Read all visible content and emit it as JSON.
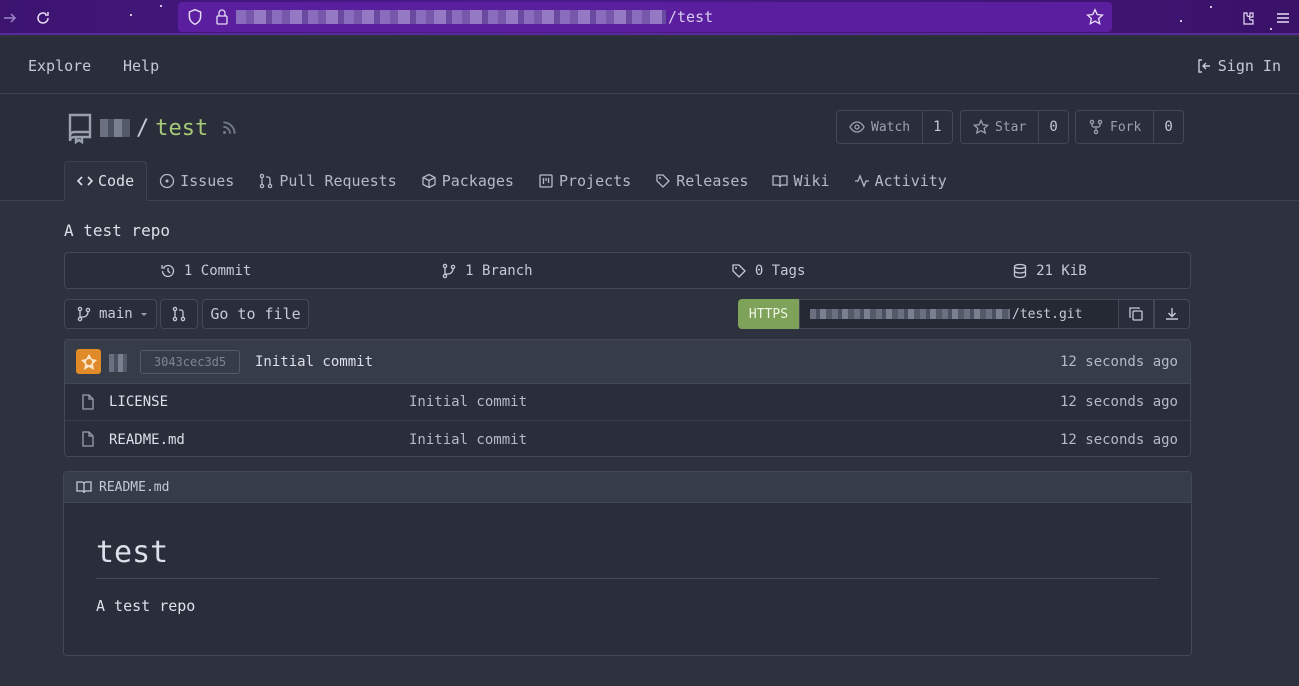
{
  "browser": {
    "url_path": "/test"
  },
  "topnav": {
    "explore": "Explore",
    "help": "Help",
    "sign_in": "Sign In"
  },
  "repo": {
    "slash": "/",
    "name": "test",
    "watch_label": "Watch",
    "watch_count": "1",
    "star_label": "Star",
    "star_count": "0",
    "fork_label": "Fork",
    "fork_count": "0",
    "description": "A test repo"
  },
  "tabs": [
    {
      "label": "Code",
      "icon": "code-icon"
    },
    {
      "label": "Issues",
      "icon": "issue-icon"
    },
    {
      "label": "Pull Requests",
      "icon": "pull-request-icon"
    },
    {
      "label": "Packages",
      "icon": "package-icon"
    },
    {
      "label": "Projects",
      "icon": "project-icon"
    },
    {
      "label": "Releases",
      "icon": "tag-icon"
    },
    {
      "label": "Wiki",
      "icon": "book-icon"
    },
    {
      "label": "Activity",
      "icon": "pulse-icon"
    }
  ],
  "summary": {
    "commits": "1 Commit",
    "branches": "1 Branch",
    "tags": "0 Tags",
    "size": "21 KiB"
  },
  "toolbar": {
    "branch": "main",
    "go_to_file": "Go to file",
    "https": "HTTPS",
    "clone_suffix": "/test.git"
  },
  "latest_commit": {
    "sha": "3043cec3d5",
    "message": "Initial commit",
    "age": "12 seconds ago"
  },
  "files": [
    {
      "name": "LICENSE",
      "message": "Initial commit",
      "age": "12 seconds ago"
    },
    {
      "name": "README.md",
      "message": "Initial commit",
      "age": "12 seconds ago"
    }
  ],
  "readme": {
    "filename": "README.md",
    "heading": "test",
    "body": "A test repo"
  },
  "colors": {
    "accent_green": "#a6c97a",
    "https_bg": "#7ea25a",
    "browser_purple": "#4a1a8c"
  }
}
